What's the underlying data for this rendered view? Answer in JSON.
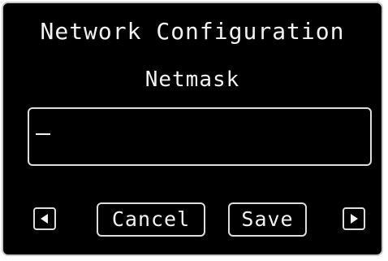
{
  "screen": {
    "title": "Network Configuration",
    "subtitle": "Netmask"
  },
  "field": {
    "value": ""
  },
  "buttons": {
    "cancel_label": "Cancel",
    "save_label": "Save",
    "prev_icon": "left-arrow-icon",
    "next_icon": "right-arrow-icon"
  },
  "colors": {
    "background": "#000000",
    "foreground": "#f2f2f2",
    "border": "#dddddd"
  }
}
